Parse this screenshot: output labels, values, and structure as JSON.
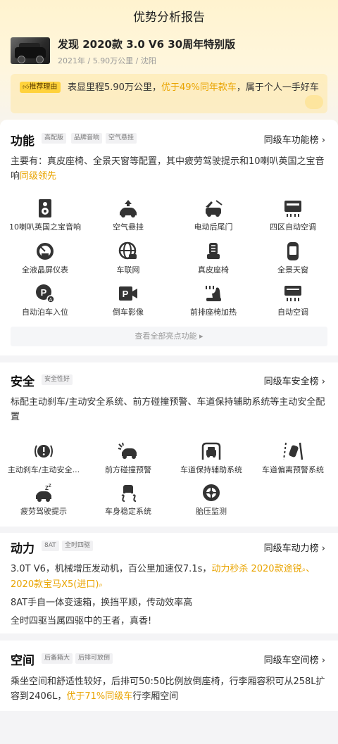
{
  "page": {
    "title": "优势分析报告"
  },
  "car": {
    "name": "发现 2020款 3.0 V6 30周年特别版",
    "meta": "2021年 / 5.90万公里 / 沈阳"
  },
  "recommend": {
    "badge": "推荐理由",
    "text_a": "表显里程5.90万公里，",
    "text_hl": "优于49%同年款车",
    "text_b": "，属于个人一手好车"
  },
  "function": {
    "title": "功能",
    "tags": [
      "高配版",
      "品牌音响",
      "空气悬挂"
    ],
    "rank_label": "同级车功能榜 ›",
    "desc_a": "主要有：真皮座椅、全景天窗等配置，其中疲劳驾驶提示和10喇叭英国之宝音响",
    "desc_hl": "同级领先",
    "items": [
      {
        "label": "10喇叭英国之宝音响",
        "icon": "speaker-icon"
      },
      {
        "label": "空气悬挂",
        "icon": "air-suspension-icon"
      },
      {
        "label": "电动后尾门",
        "icon": "power-tailgate-icon"
      },
      {
        "label": "四区自动空调",
        "icon": "climate-control-icon"
      },
      {
        "label": "全液晶屏仪表",
        "icon": "lcd-gauge-icon"
      },
      {
        "label": "车联网",
        "icon": "connected-car-icon"
      },
      {
        "label": "真皮座椅",
        "icon": "leather-seat-icon"
      },
      {
        "label": "全景天窗",
        "icon": "panoramic-sunroof-icon"
      },
      {
        "label": "自动泊车入位",
        "icon": "auto-parking-icon"
      },
      {
        "label": "倒车影像",
        "icon": "reverse-camera-icon"
      },
      {
        "label": "前排座椅加热",
        "icon": "seat-heating-icon"
      },
      {
        "label": "自动空调",
        "icon": "auto-ac-icon"
      }
    ],
    "more_label": "查看全部亮点功能 ▸"
  },
  "safety": {
    "title": "安全",
    "tags": [
      "安全性好"
    ],
    "rank_label": "同级车安全榜 ›",
    "desc": "标配主动刹车/主动安全系统、前方碰撞预警、车道保持辅助系统等主动安全配置",
    "items": [
      {
        "label": "主动刹车/主动安全...",
        "icon": "active-brake-icon"
      },
      {
        "label": "前方碰撞预警",
        "icon": "collision-warning-icon"
      },
      {
        "label": "车道保持辅助系统",
        "icon": "lane-keep-icon"
      },
      {
        "label": "车道偏离预警系统",
        "icon": "lane-departure-icon"
      },
      {
        "label": "疲劳驾驶提示",
        "icon": "fatigue-alert-icon"
      },
      {
        "label": "车身稳定系统",
        "icon": "stability-control-icon"
      },
      {
        "label": "胎压监测",
        "icon": "tire-pressure-icon"
      }
    ]
  },
  "power": {
    "title": "动力",
    "tags": [
      "8AT",
      "全时四驱"
    ],
    "rank_label": "同级车动力榜 ›",
    "line1_a": "3.0T V6，机械增压发动机，百公里加速仅7.1s，",
    "line1_hl": "动力秒杀 2020款途锐",
    "line1_sep": "、",
    "line1_hl2": "2020款宝马X5(进口)",
    "line2": "8AT手自一体变速箱，换挡平顺，传动效率高",
    "line3": "全时四驱当属四驱中的王者，真香!"
  },
  "space": {
    "title": "空间",
    "tags": [
      "后备箱大",
      "后排可放倒"
    ],
    "rank_label": "同级车空间榜 ›",
    "desc_a": "乘坐空间和舒适性较好，后排可50:50比例放倒座椅，行李厢容积可从258L扩容到2406L，",
    "desc_hl": "优于71%同级车",
    "desc_b": "行李厢空间"
  },
  "colors": {
    "accent": "#e9a400",
    "badge": "#ffd23c",
    "icon": "#333333"
  }
}
